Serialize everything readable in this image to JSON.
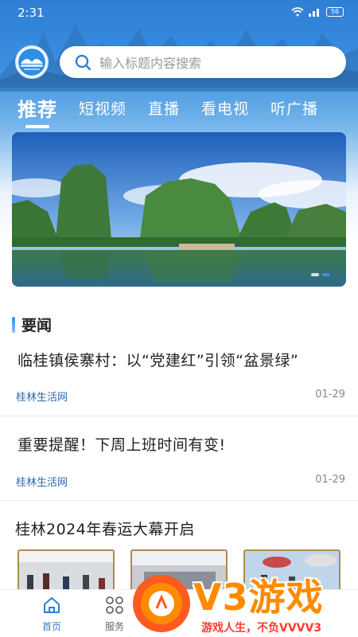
{
  "status_bar": {
    "time": "2:31",
    "battery": "56"
  },
  "search": {
    "placeholder": "输入标题内容搜索"
  },
  "tabs": [
    {
      "label": "推荐",
      "active": true
    },
    {
      "label": "短视频",
      "active": false
    },
    {
      "label": "直播",
      "active": false
    },
    {
      "label": "看电视",
      "active": false
    },
    {
      "label": "听广播",
      "active": false
    }
  ],
  "banner": {
    "slides": 2,
    "active_index": 1
  },
  "news_section": {
    "title": "要闻"
  },
  "news": [
    {
      "title": "临桂镇侯寨村：以“党建红”引领“盆景绿”",
      "source": "桂林生活网",
      "date": "01-29"
    },
    {
      "title": "重要提醒！下周上班时间有变!",
      "source": "桂林生活网",
      "date": "01-29"
    },
    {
      "title": "桂林2024年春运大幕开启"
    }
  ],
  "bottom_nav": [
    {
      "label": "首页",
      "icon": "home-icon",
      "active": true
    },
    {
      "label": "服务",
      "icon": "grid-icon",
      "active": false
    }
  ],
  "watermark": {
    "brand": "V3游戏",
    "slogan": "游戏人生，不负VVVV3"
  },
  "colors": {
    "accent": "#2f7fd6",
    "source_text": "#2c6aa8",
    "watermark_orange": "#ff8a00"
  }
}
